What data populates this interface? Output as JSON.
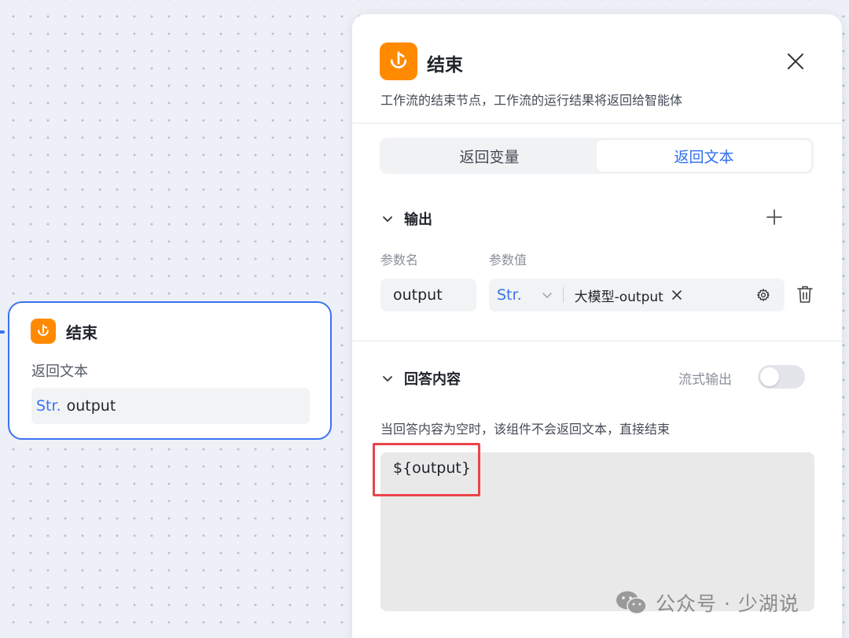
{
  "node": {
    "title": "结束",
    "subtitle": "返回文本",
    "var_type": "Str.",
    "var_name": "output"
  },
  "panel": {
    "title": "结束",
    "description": "工作流的结束节点，工作流的运行结果将返回给智能体",
    "tabs": [
      {
        "label": "返回变量",
        "active": false
      },
      {
        "label": "返回文本",
        "active": true
      }
    ],
    "output": {
      "section_label": "输出",
      "col_name_label": "参数名",
      "col_value_label": "参数值",
      "param_name": "output",
      "value_type": "Str.",
      "value_ref": "大模型-output"
    },
    "answer": {
      "section_label": "回答内容",
      "stream_label": "流式输出",
      "stream_enabled": false,
      "hint": "当回答内容为空时，该组件不会返回文本，直接结束",
      "content": "${output}"
    }
  },
  "watermark": "公众号 · 少湖说",
  "colors": {
    "accent": "#2f6fed",
    "node_icon": "#ff8a00",
    "highlight_box": "#e8454a"
  }
}
